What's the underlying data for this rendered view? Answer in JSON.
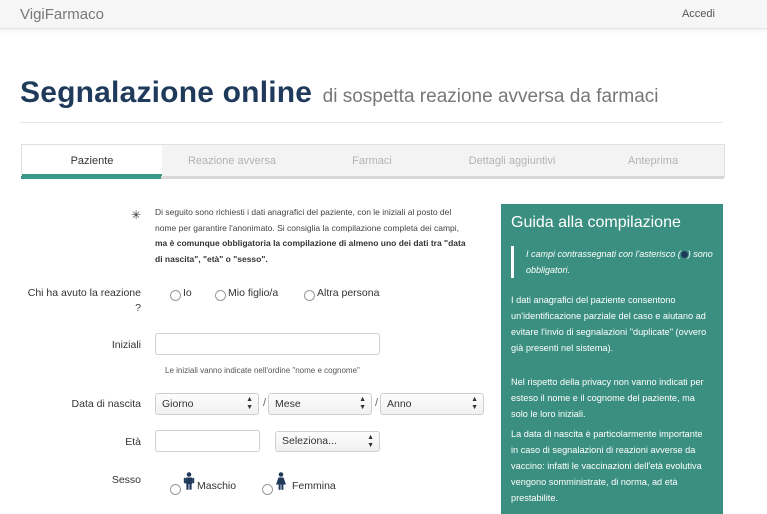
{
  "navbar": {
    "brand": "VigiFarmaco",
    "login": "Accedi"
  },
  "title": {
    "main": "Segnalazione online",
    "subtitle": "di sospetta reazione avversa da farmaci"
  },
  "tabs": [
    {
      "label": "Paziente",
      "active": true
    },
    {
      "label": "Reazione avversa",
      "active": false
    },
    {
      "label": "Farmaci",
      "active": false
    },
    {
      "label": "Dettagli aggiuntivi",
      "active": false
    },
    {
      "label": "Anteprima",
      "active": false
    }
  ],
  "intro": {
    "asterisk": "✳",
    "normal": "Di seguito sono richiesti i dati anagrafici del paziente, con le iniziali al posto del nome per garantire l'anonimato. Si consiglia la compilazione completa dei campi,",
    "bold": "ma è comunque obbligatoria la compilazione di almeno uno dei dati tra \"data di nascita\", \"età\" o \"sesso\"."
  },
  "form": {
    "who": {
      "label_line1": "Chi ha avuto la reazione",
      "label_line2": "?",
      "options": [
        "Io",
        "Mio figlio/a",
        "Altra persona"
      ]
    },
    "initials": {
      "label": "Iniziali",
      "value": "",
      "help": "Le iniziali vanno indicate nell'ordine \"nome e cognome\""
    },
    "birth": {
      "label": "Data di nascita",
      "day": "Giorno",
      "month": "Mese",
      "year": "Anno",
      "separator": "/"
    },
    "age": {
      "label": "Età",
      "value": "",
      "unit": "Seleziona..."
    },
    "sex": {
      "label": "Sesso",
      "male": "Maschio",
      "female": "Femmina"
    }
  },
  "guide": {
    "title": "Guida alla compilazione",
    "quote_before": "I campi contrassegnati con l'asterisco (",
    "quote_after": ") sono obbligatori.",
    "p1": "I dati anagrafici del paziente consentono un'identificazione parziale del caso e aiutano ad evitare l'invio di segnalazioni \"duplicate\" (ovvero già presenti nel sistema).",
    "p2": "Nel rispetto della privacy non vanno indicati per esteso il nome e il cognome del paziente, ma solo le loro iniziali.",
    "p3": "La data di nascita è particolarmente importante in caso di segnalazioni di reazioni avverse da vaccino: infatti le vaccinazioni dell'età evolutiva vengono somministrate, di norma, ad età prestabilite."
  },
  "colors": {
    "accent": "#3a9a8a",
    "guide_bg": "#3a8f80",
    "title": "#1f3a5a"
  }
}
